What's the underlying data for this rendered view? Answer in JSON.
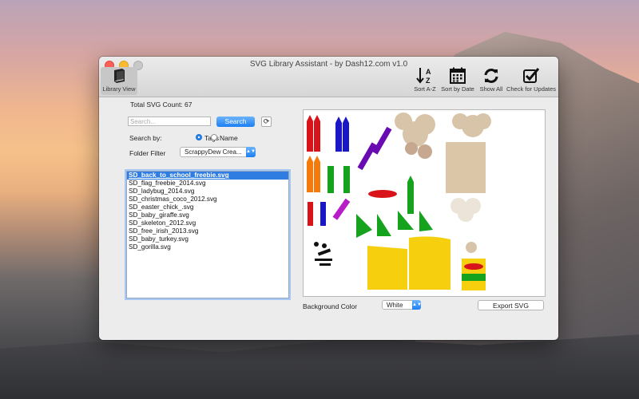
{
  "window": {
    "title": "SVG Library Assistant - by Dash12.com  v1.0"
  },
  "toolbar": {
    "library_view": "Library View",
    "sort_az": "Sort A-Z",
    "sort_date": "Sort by Date",
    "show_all": "Show All",
    "check_updates": "Check for Updates"
  },
  "library": {
    "total_label": "Total SVG Count: 67",
    "search_placeholder": "Search...",
    "search_button": "Search",
    "search_by_label": "Search by:",
    "option_tags": "Tags",
    "option_name": "Name",
    "search_by_selected": "Tags",
    "folder_filter_label": "Folder Filter",
    "folder_filter_value": "ScrappyDew Crea...",
    "files": [
      "SD_back_to_school_freebie.svg",
      "SD_flag_freebie_2014.svg",
      "SD_ladybug_2014.svg",
      "SD_christmas_coco_2012.svg",
      "SD_easter_chick_.svg",
      "SD_baby_giraffe.svg",
      "SD_skeleton_2012.svg",
      "SD_free_irish_2013.svg",
      "SD_baby_turkey.svg",
      "SD_gorilla.svg"
    ],
    "selected_file": "SD_back_to_school_freebie.svg"
  },
  "preview": {
    "background_label": "Background Color",
    "background_value": "White",
    "export_button": "Export SVG",
    "crayons_text": "Crayons"
  },
  "colors": {
    "accent": "#2f7de1",
    "selection": "#2f7de1"
  }
}
